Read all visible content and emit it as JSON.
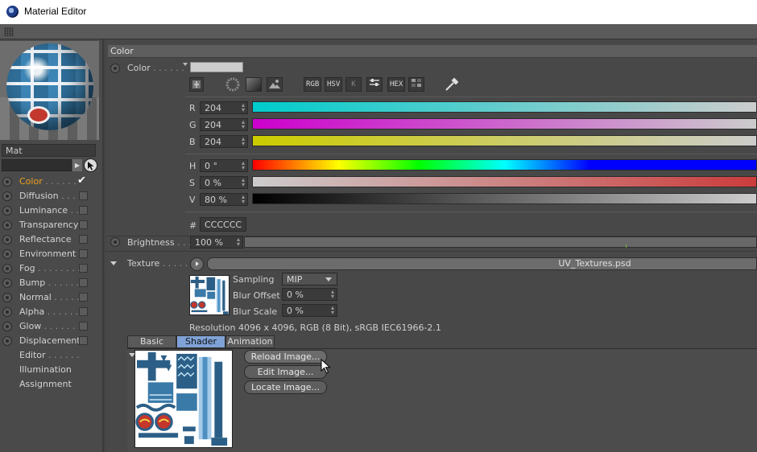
{
  "window": {
    "title": "Material Editor"
  },
  "material": {
    "name": "Mat"
  },
  "channels": [
    {
      "label": "Color",
      "dots": " . . . . . .",
      "enabled": true,
      "active": true
    },
    {
      "label": "Diffusion",
      "dots": " . . .",
      "enabled": false
    },
    {
      "label": "Luminance",
      "dots": " . .",
      "enabled": false
    },
    {
      "label": "Transparency",
      "dots": "",
      "enabled": false
    },
    {
      "label": "Reflectance",
      "dots": "",
      "enabled": false
    },
    {
      "label": "Environment",
      "dots": "",
      "enabled": false
    },
    {
      "label": "Fog",
      "dots": " . . . . . . . .",
      "enabled": false
    },
    {
      "label": "Bump",
      "dots": " . . . . . .",
      "enabled": false
    },
    {
      "label": "Normal",
      "dots": " . . . . .",
      "enabled": false
    },
    {
      "label": "Alpha",
      "dots": " . . . . . .",
      "enabled": false
    },
    {
      "label": "Glow",
      "dots": " . . . . . . .",
      "enabled": false
    },
    {
      "label": "Displacement",
      "dots": "",
      "enabled": false
    },
    {
      "label": "Editor",
      "dots": " . . . . . .",
      "noCheck": true
    },
    {
      "label": "Illumination",
      "dots": "",
      "noCheck": true
    },
    {
      "label": "Assignment",
      "dots": "",
      "noCheck": true
    }
  ],
  "section": {
    "title": "Color"
  },
  "color": {
    "label": "Color",
    "dots": " . . . . . .",
    "swatch": "#cccccc",
    "modes": [
      "RGB",
      "HSV",
      "K",
      "",
      "HEX",
      ""
    ],
    "rgb": {
      "r": {
        "key": "R",
        "value": "204"
      },
      "g": {
        "key": "G",
        "value": "204"
      },
      "b": {
        "key": "B",
        "value": "204"
      }
    },
    "hsv": {
      "h": {
        "key": "H",
        "value": "0 °"
      },
      "s": {
        "key": "S",
        "value": "0 %"
      },
      "v": {
        "key": "V",
        "value": "80 %"
      }
    },
    "hex": {
      "key": "#",
      "value": "CCCCCC"
    }
  },
  "brightness": {
    "label": "Brightness",
    "dots": " . . .",
    "value": "100 %"
  },
  "texture": {
    "label": "Texture",
    "dots": " . . . . . .",
    "file": "UV_Textures.psd",
    "sampling": {
      "label": "Sampling",
      "value": "MIP"
    },
    "blur_offset": {
      "label": "Blur Offset",
      "value": "0 %"
    },
    "blur_scale": {
      "label": "Blur Scale",
      "value": "0 %"
    },
    "resolution": "Resolution 4096 x 4096, RGB (8 Bit), sRGB IEC61966-2.1"
  },
  "tabs": [
    "Basic",
    "Shader",
    "Animation"
  ],
  "active_tab": "Shader",
  "buttons": {
    "reload": "Reload Image...",
    "edit": "Edit Image...",
    "locate": "Locate Image..."
  }
}
